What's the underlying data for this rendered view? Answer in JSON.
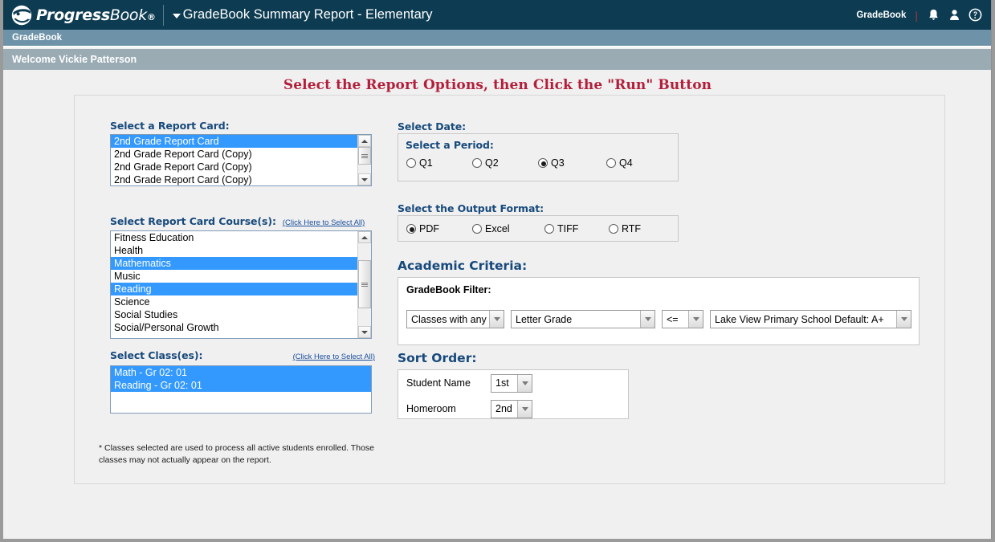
{
  "header": {
    "brand_bold": "Progress",
    "brand_light": "Book",
    "page_title": "GradeBook Summary Report - Elementary",
    "right_label": "GradeBook",
    "separator": "|",
    "icons": [
      "bell-icon",
      "user-icon",
      "help-icon"
    ]
  },
  "navbar": {
    "item": "GradeBook"
  },
  "welcome": {
    "text": "Welcome Vickie Patterson"
  },
  "page": {
    "headline": "Select the Report Options, then Click the \"Run\" Button",
    "footnote": "* Classes selected are used to process all active students enrolled.  Those classes may not actually appear on the report."
  },
  "report_card": {
    "label": "Select a Report Card:",
    "items": [
      {
        "text": "2nd Grade Report Card",
        "selected": true
      },
      {
        "text": "2nd Grade Report Card (Copy)",
        "selected": false
      },
      {
        "text": "2nd Grade Report Card (Copy)",
        "selected": false
      },
      {
        "text": "2nd Grade Report Card (Copy)",
        "selected": false
      }
    ]
  },
  "courses": {
    "label": "Select Report Card Course(s):",
    "select_all": "(Click Here to Select All)",
    "items": [
      {
        "text": "Fitness Education",
        "selected": false
      },
      {
        "text": "Health",
        "selected": false
      },
      {
        "text": "Mathematics",
        "selected": true
      },
      {
        "text": "Music",
        "selected": false
      },
      {
        "text": "Reading",
        "selected": true
      },
      {
        "text": "Science",
        "selected": false
      },
      {
        "text": "Social Studies",
        "selected": false
      },
      {
        "text": "Social/Personal Growth",
        "selected": false
      }
    ]
  },
  "classes": {
    "label": "Select Class(es):",
    "select_all": "(Click Here to Select All)",
    "items": [
      {
        "text": "Math - Gr 02: 01",
        "selected": true
      },
      {
        "text": "Reading - Gr 02: 01",
        "selected": true
      }
    ]
  },
  "date": {
    "label": "Select Date:",
    "period_label": "Select a Period:",
    "options": [
      {
        "label": "Q1",
        "selected": false
      },
      {
        "label": "Q2",
        "selected": false
      },
      {
        "label": "Q3",
        "selected": true
      },
      {
        "label": "Q4",
        "selected": false
      }
    ]
  },
  "output_format": {
    "label": "Select the Output Format:",
    "options": [
      {
        "label": "PDF",
        "selected": true
      },
      {
        "label": "Excel",
        "selected": false
      },
      {
        "label": "TIFF",
        "selected": false
      },
      {
        "label": "RTF",
        "selected": false
      }
    ]
  },
  "academic_criteria": {
    "label": "Academic Criteria:",
    "filter_label": "GradeBook Filter:",
    "filters": [
      {
        "value": "Classes with any"
      },
      {
        "value": "Letter Grade"
      },
      {
        "value": "<="
      },
      {
        "value": "Lake View Primary School Default: A+"
      }
    ]
  },
  "sort_order": {
    "label": "Sort Order:",
    "rows": [
      {
        "label": "Student Name",
        "value": "1st"
      },
      {
        "label": "Homeroom",
        "value": "2nd"
      }
    ]
  },
  "colors": {
    "brand_dark": "#0d3c52",
    "nav_blue": "#6e93a8",
    "welcome_gray": "#9aabb4",
    "headline_red": "#b21f3b",
    "label_blue": "#174a7c",
    "selection_blue": "#3399ff"
  }
}
